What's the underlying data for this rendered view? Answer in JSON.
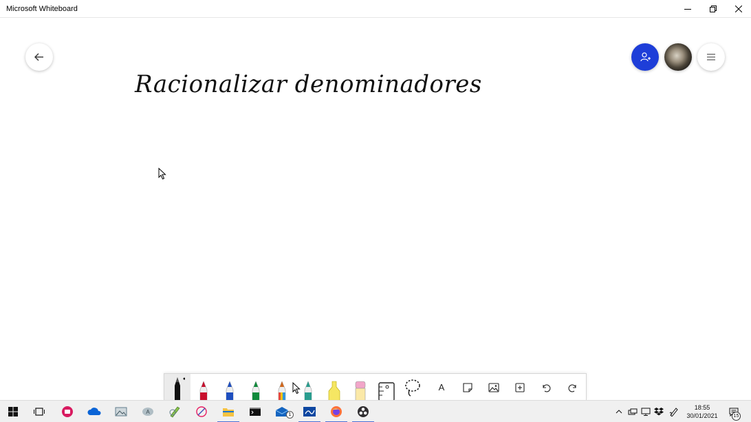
{
  "window": {
    "title": "Microsoft Whiteboard",
    "controls": [
      "minimize-icon",
      "restore-icon",
      "close-icon"
    ]
  },
  "canvas": {
    "handwritten_text": "Racionalizar denominadores",
    "back_button_icon": "arrow-left-icon",
    "share_button_icon": "add-person-icon",
    "avatar": "user-avatar",
    "menu_icon": "hamburger-menu-icon",
    "accent_color": "#1e3ed8"
  },
  "toolbar": {
    "tools": [
      {
        "name": "black-pen",
        "icon": "pen-icon",
        "color": "#111111",
        "selected": true
      },
      {
        "name": "red-pen",
        "icon": "pen-icon",
        "color": "#c8102e"
      },
      {
        "name": "blue-pen",
        "icon": "pen-icon",
        "color": "#1f4fbf"
      },
      {
        "name": "green-pen",
        "icon": "pen-icon",
        "color": "#108a3c"
      },
      {
        "name": "rainbow-pen",
        "icon": "pen-icon",
        "color": "#d2691e"
      },
      {
        "name": "galaxy-pen",
        "icon": "pen-icon",
        "color": "#2a9d8f"
      },
      {
        "name": "highlighter",
        "icon": "highlighter-icon",
        "color": "#f5e663"
      },
      {
        "name": "eraser",
        "icon": "eraser-icon",
        "color": "#f2a6c9"
      },
      {
        "name": "ruler",
        "icon": "ruler-icon"
      },
      {
        "name": "lasso",
        "icon": "lasso-icon"
      },
      {
        "name": "text",
        "icon": "text-icon",
        "glyph": "A"
      },
      {
        "name": "note",
        "icon": "note-icon"
      },
      {
        "name": "image",
        "icon": "image-icon"
      },
      {
        "name": "add",
        "icon": "add-icon"
      },
      {
        "name": "undo",
        "icon": "undo-icon"
      },
      {
        "name": "redo",
        "icon": "redo-icon"
      }
    ]
  },
  "taskbar": {
    "apps": [
      "start-icon",
      "task-view-icon",
      "screen-recorder-icon",
      "onedrive-icon",
      "photos-icon",
      "app-icon",
      "paint-icon",
      "snip-icon",
      "file-explorer-icon",
      "terminal-icon",
      "mail-icon",
      "whiteboard-icon",
      "firefox-icon",
      "obs-icon"
    ],
    "mail_badge": "1",
    "time": "18:55",
    "date": "30/01/2021",
    "notifications_count": "15"
  }
}
